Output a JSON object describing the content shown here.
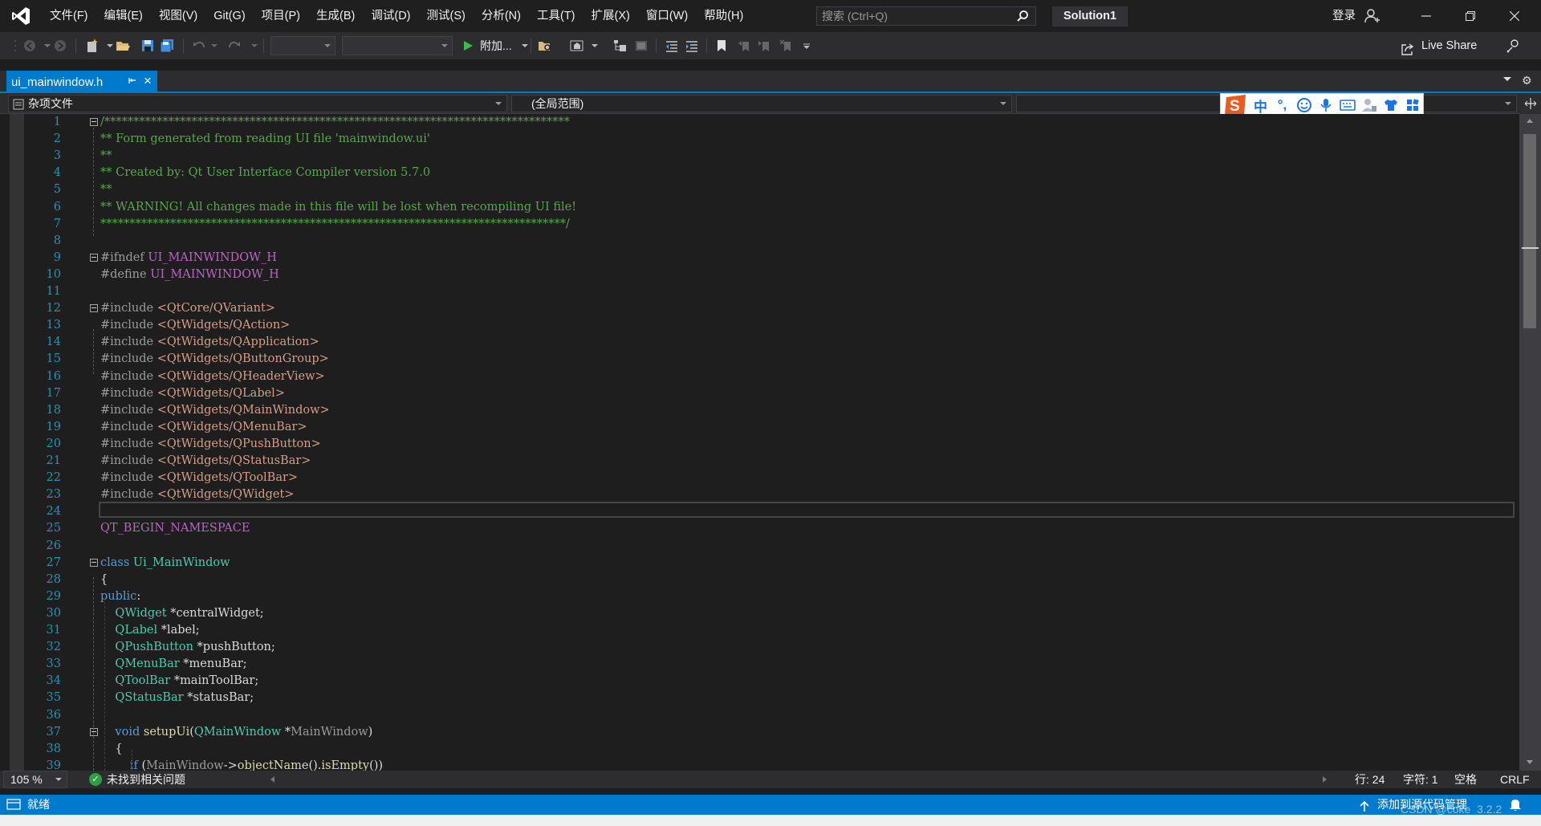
{
  "app": {
    "solution_name": "Solution1",
    "login_label": "登录"
  },
  "menu": {
    "items": [
      "文件(F)",
      "编辑(E)",
      "视图(V)",
      "Git(G)",
      "项目(P)",
      "生成(B)",
      "调试(D)",
      "测试(S)",
      "分析(N)",
      "工具(T)",
      "扩展(X)",
      "窗口(W)",
      "帮助(H)"
    ]
  },
  "search": {
    "placeholder": "搜索 (Ctrl+Q)"
  },
  "toolbar": {
    "attach_label": "附加...",
    "live_share_label": "Live Share"
  },
  "tab": {
    "title": "ui_mainwindow.h"
  },
  "navbar": {
    "project": "杂项文件",
    "scope": "(全局范围)",
    "member": ""
  },
  "ime": {
    "mode": "中",
    "punct": "°,"
  },
  "editor": {
    "current_line": 24,
    "lines": [
      {
        "n": "1",
        "fold": true,
        "parts": [
          {
            "c": "comment",
            "t": "/********************************************************************************"
          }
        ]
      },
      {
        "n": "2",
        "parts": [
          {
            "c": "comment",
            "t": "** Form generated from reading UI file 'mainwindow.ui'"
          }
        ]
      },
      {
        "n": "3",
        "parts": [
          {
            "c": "comment",
            "t": "**"
          }
        ]
      },
      {
        "n": "4",
        "parts": [
          {
            "c": "comment",
            "t": "** Created by: Qt User Interface Compiler version 5.7.0"
          }
        ]
      },
      {
        "n": "5",
        "parts": [
          {
            "c": "comment",
            "t": "**"
          }
        ]
      },
      {
        "n": "6",
        "parts": [
          {
            "c": "comment",
            "t": "** WARNING! All changes made in this file will be lost when recompiling UI file!"
          }
        ]
      },
      {
        "n": "7",
        "parts": [
          {
            "c": "comment",
            "t": "********************************************************************************/"
          }
        ]
      },
      {
        "n": "8",
        "parts": []
      },
      {
        "n": "9",
        "fold": true,
        "parts": [
          {
            "c": "pp",
            "t": "#ifndef "
          },
          {
            "c": "macro",
            "t": "UI_MAINWINDOW_H"
          }
        ]
      },
      {
        "n": "10",
        "parts": [
          {
            "c": "pp",
            "t": "#define "
          },
          {
            "c": "macro",
            "t": "UI_MAINWINDOW_H"
          }
        ]
      },
      {
        "n": "11",
        "parts": []
      },
      {
        "n": "12",
        "fold": true,
        "parts": [
          {
            "c": "pp",
            "t": "#include "
          },
          {
            "c": "str",
            "t": "<QtCore/QVariant>"
          }
        ]
      },
      {
        "n": "13",
        "parts": [
          {
            "c": "pp",
            "t": "#include "
          },
          {
            "c": "str",
            "t": "<QtWidgets/QAction>"
          }
        ]
      },
      {
        "n": "14",
        "parts": [
          {
            "c": "pp",
            "t": "#include "
          },
          {
            "c": "str",
            "t": "<QtWidgets/QApplication>"
          }
        ]
      },
      {
        "n": "15",
        "parts": [
          {
            "c": "pp",
            "t": "#include "
          },
          {
            "c": "str",
            "t": "<QtWidgets/QButtonGroup>"
          }
        ]
      },
      {
        "n": "16",
        "parts": [
          {
            "c": "pp",
            "t": "#include "
          },
          {
            "c": "str",
            "t": "<QtWidgets/QHeaderView>"
          }
        ]
      },
      {
        "n": "17",
        "parts": [
          {
            "c": "pp",
            "t": "#include "
          },
          {
            "c": "str",
            "t": "<QtWidgets/QLabel>"
          }
        ]
      },
      {
        "n": "18",
        "parts": [
          {
            "c": "pp",
            "t": "#include "
          },
          {
            "c": "str",
            "t": "<QtWidgets/QMainWindow>"
          }
        ]
      },
      {
        "n": "19",
        "parts": [
          {
            "c": "pp",
            "t": "#include "
          },
          {
            "c": "str",
            "t": "<QtWidgets/QMenuBar>"
          }
        ]
      },
      {
        "n": "20",
        "parts": [
          {
            "c": "pp",
            "t": "#include "
          },
          {
            "c": "str",
            "t": "<QtWidgets/QPushButton>"
          }
        ]
      },
      {
        "n": "21",
        "parts": [
          {
            "c": "pp",
            "t": "#include "
          },
          {
            "c": "str",
            "t": "<QtWidgets/QStatusBar>"
          }
        ]
      },
      {
        "n": "22",
        "parts": [
          {
            "c": "pp",
            "t": "#include "
          },
          {
            "c": "str",
            "t": "<QtWidgets/QToolBar>"
          }
        ]
      },
      {
        "n": "23",
        "parts": [
          {
            "c": "pp",
            "t": "#include "
          },
          {
            "c": "str",
            "t": "<QtWidgets/QWidget>"
          }
        ]
      },
      {
        "n": "24",
        "parts": []
      },
      {
        "n": "25",
        "parts": [
          {
            "c": "macro",
            "t": "QT_BEGIN_NAMESPACE"
          }
        ]
      },
      {
        "n": "26",
        "parts": []
      },
      {
        "n": "27",
        "fold": true,
        "parts": [
          {
            "c": "kw",
            "t": "class "
          },
          {
            "c": "type",
            "t": "Ui_MainWindow"
          }
        ]
      },
      {
        "n": "28",
        "parts": [
          {
            "c": "plain",
            "t": "{"
          }
        ]
      },
      {
        "n": "29",
        "parts": [
          {
            "c": "kw",
            "t": "public"
          },
          {
            "c": "plain",
            "t": ":"
          }
        ]
      },
      {
        "n": "30",
        "parts": [
          {
            "c": "type",
            "t": "    QWidget "
          },
          {
            "c": "plain",
            "t": "*"
          },
          {
            "c": "field",
            "t": "centralWidget"
          },
          {
            "c": "plain",
            "t": ";"
          }
        ]
      },
      {
        "n": "31",
        "parts": [
          {
            "c": "type",
            "t": "    QLabel "
          },
          {
            "c": "plain",
            "t": "*"
          },
          {
            "c": "field",
            "t": "label"
          },
          {
            "c": "plain",
            "t": ";"
          }
        ]
      },
      {
        "n": "32",
        "parts": [
          {
            "c": "type",
            "t": "    QPushButton "
          },
          {
            "c": "plain",
            "t": "*"
          },
          {
            "c": "field",
            "t": "pushButton"
          },
          {
            "c": "plain",
            "t": ";"
          }
        ]
      },
      {
        "n": "33",
        "parts": [
          {
            "c": "type",
            "t": "    QMenuBar "
          },
          {
            "c": "plain",
            "t": "*"
          },
          {
            "c": "field",
            "t": "menuBar"
          },
          {
            "c": "plain",
            "t": ";"
          }
        ]
      },
      {
        "n": "34",
        "parts": [
          {
            "c": "type",
            "t": "    QToolBar "
          },
          {
            "c": "plain",
            "t": "*"
          },
          {
            "c": "field",
            "t": "mainToolBar"
          },
          {
            "c": "plain",
            "t": ";"
          }
        ]
      },
      {
        "n": "35",
        "parts": [
          {
            "c": "type",
            "t": "    QStatusBar "
          },
          {
            "c": "plain",
            "t": "*"
          },
          {
            "c": "field",
            "t": "statusBar"
          },
          {
            "c": "plain",
            "t": ";"
          }
        ]
      },
      {
        "n": "36",
        "parts": []
      },
      {
        "n": "37",
        "fold": true,
        "parts": [
          {
            "c": "kw",
            "t": "    void "
          },
          {
            "c": "fn",
            "t": "setupUi"
          },
          {
            "c": "plain",
            "t": "("
          },
          {
            "c": "type",
            "t": "QMainWindow "
          },
          {
            "c": "plain",
            "t": "*"
          },
          {
            "c": "param",
            "t": "MainWindow"
          },
          {
            "c": "plain",
            "t": ")"
          }
        ]
      },
      {
        "n": "38",
        "parts": [
          {
            "c": "plain",
            "t": "    {"
          }
        ]
      },
      {
        "n": "39",
        "parts": [
          {
            "c": "kw",
            "t": "        if "
          },
          {
            "c": "plain",
            "t": "("
          },
          {
            "c": "param",
            "t": "MainWindow"
          },
          {
            "c": "plain",
            "t": "->"
          },
          {
            "c": "fn",
            "t": "objectName"
          },
          {
            "c": "plain",
            "t": "()."
          },
          {
            "c": "fn",
            "t": "isEmpty"
          },
          {
            "c": "plain",
            "t": "())"
          }
        ]
      }
    ]
  },
  "infobar": {
    "zoom": "105 %",
    "issues": "未找到相关问题",
    "line": "行: 24",
    "char": "字符: 1",
    "whitespace": "空格",
    "eol": "CRLF"
  },
  "status": {
    "ready": "就绪",
    "scm": "添加到源代码管理",
    "watermark": "CSDN @coke_3.2.2"
  },
  "colors": {
    "accent": "#007acc",
    "comment": "#57a64a",
    "keyword": "#569cd6",
    "type": "#4ec9b0",
    "string": "#d69d85",
    "macro": "#bd63c5",
    "line_number": "#2b91af"
  }
}
